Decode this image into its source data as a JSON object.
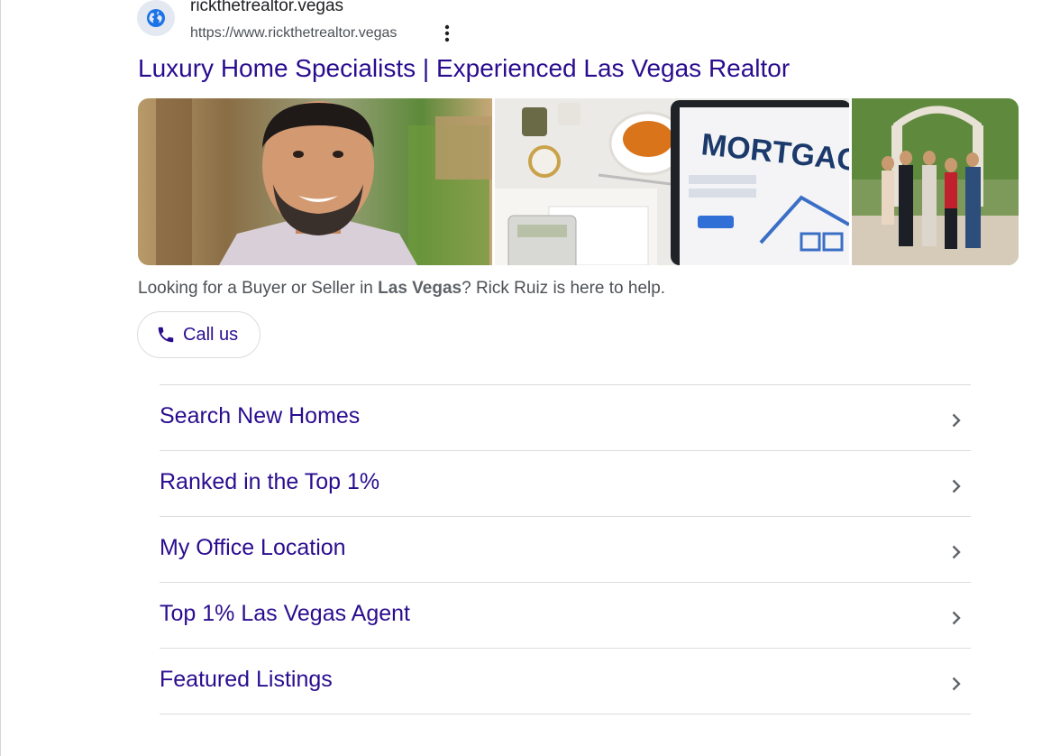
{
  "site": {
    "name": "rickthetrealtor.vegas",
    "url": "https://www.rickthetrealtor.vegas",
    "favicon_icon": "globe-icon"
  },
  "result": {
    "title": "Luxury Home Specialists | Experienced Las Vegas Realtor",
    "snippet_before": "Looking for a Buyer or Seller in ",
    "snippet_bold": "Las Vegas",
    "snippet_after": "? Rick Ruiz is here to help."
  },
  "images": [
    {
      "description": "realtor-portrait"
    },
    {
      "description": "mortgage-laptop",
      "overlay_text": "MORTGAG"
    },
    {
      "description": "team-photo"
    }
  ],
  "call_button": {
    "label": "Call us",
    "icon": "phone-icon"
  },
  "sitelinks": [
    {
      "label": "Search New Homes"
    },
    {
      "label": "Ranked in the Top 1%"
    },
    {
      "label": "My Office Location"
    },
    {
      "label": "Top 1% Las Vegas Agent"
    },
    {
      "label": "Featured Listings"
    }
  ],
  "colors": {
    "link": "#2a0d8f",
    "text": "#4d5156",
    "divider": "#dadce0",
    "favicon_bg": "#e3e8f1",
    "favicon_fg": "#1a73e8"
  }
}
